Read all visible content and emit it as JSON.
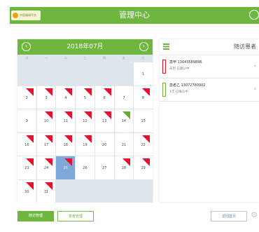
{
  "topbar": {
    "title": "管理中心",
    "logo_text": "中国福禄平台"
  },
  "calendar": {
    "month_label": "2018年07月",
    "weekdays": [
      "日",
      "一",
      "二",
      "三",
      "四",
      "五",
      "六"
    ],
    "cells": [
      {
        "day": "",
        "flag": ""
      },
      {
        "day": "",
        "flag": ""
      },
      {
        "day": "",
        "flag": ""
      },
      {
        "day": "",
        "flag": ""
      },
      {
        "day": "",
        "flag": ""
      },
      {
        "day": "",
        "flag": ""
      },
      {
        "day": "1",
        "flag": ""
      },
      {
        "day": "2",
        "flag": "red"
      },
      {
        "day": "3",
        "flag": "red"
      },
      {
        "day": "4",
        "flag": "red"
      },
      {
        "day": "5",
        "flag": "red"
      },
      {
        "day": "6",
        "flag": "red"
      },
      {
        "day": "7",
        "flag": ""
      },
      {
        "day": "8",
        "flag": "red"
      },
      {
        "day": "9",
        "flag": ""
      },
      {
        "day": "10",
        "flag": "red"
      },
      {
        "day": "11",
        "flag": "red"
      },
      {
        "day": "12",
        "flag": "red"
      },
      {
        "day": "13",
        "flag": "red"
      },
      {
        "day": "14",
        "flag": "green"
      },
      {
        "day": "15",
        "flag": ""
      },
      {
        "day": "16",
        "flag": "red"
      },
      {
        "day": "17",
        "flag": "red"
      },
      {
        "day": "18",
        "flag": "red"
      },
      {
        "day": "19",
        "flag": "red"
      },
      {
        "day": "20",
        "flag": ""
      },
      {
        "day": "21",
        "flag": ""
      },
      {
        "day": "22",
        "flag": "red"
      },
      {
        "day": "23",
        "flag": "red"
      },
      {
        "day": "24",
        "flag": "red"
      },
      {
        "day": "25",
        "flag": "red",
        "today": true
      },
      {
        "day": "26",
        "flag": ""
      },
      {
        "day": "27",
        "flag": ""
      },
      {
        "day": "28",
        "flag": "red"
      },
      {
        "day": "29",
        "flag": "red"
      },
      {
        "day": "30",
        "flag": "red"
      },
      {
        "day": "31",
        "flag": "red"
      },
      {
        "day": "",
        "flag": ""
      },
      {
        "day": "",
        "flag": ""
      },
      {
        "day": "",
        "flag": ""
      },
      {
        "day": "",
        "flag": ""
      },
      {
        "day": "",
        "flag": ""
      }
    ]
  },
  "panel": {
    "title": "随访患者",
    "items": [
      {
        "line1": "患甲  13043589896",
        "line2": "未到 已确认中",
        "status": "red"
      },
      {
        "line1": "患者乙  13072780902",
        "line2": "1次 已确认中",
        "status": "green"
      }
    ]
  },
  "bottom": {
    "btn1": "随访管理",
    "btn2": "患者管理",
    "btn3": "返回首页"
  },
  "icons": {
    "prev": "chevron-left-icon",
    "next": "chevron-right-icon",
    "list": "list-icon",
    "gear": "gear-icon"
  },
  "colors": {
    "brand": "#6fb63f",
    "flag_red": "#e8102a",
    "today": "#7ea9d8"
  }
}
